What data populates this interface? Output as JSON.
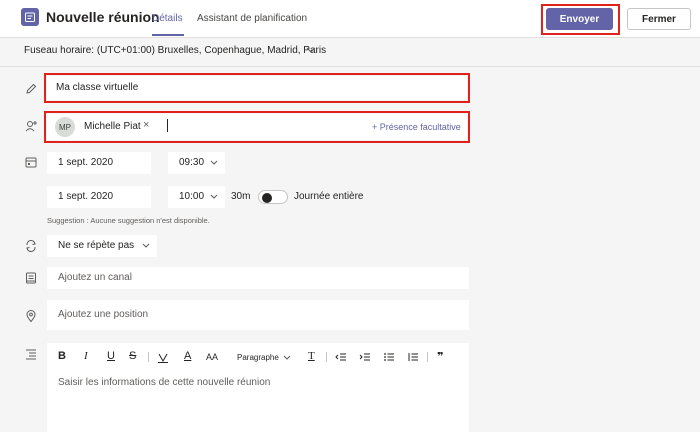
{
  "header": {
    "title": "Nouvelle réunion",
    "tabs": [
      {
        "label": "Détails",
        "active": true
      },
      {
        "label": "Assistant de planification",
        "active": false
      }
    ],
    "send_label": "Envoyer",
    "close_label": "Fermer"
  },
  "timezone": {
    "label": "Fuseau horaire: (UTC+01:00) Bruxelles, Copenhague, Madrid, Paris"
  },
  "subject": {
    "value": "Ma classe virtuelle"
  },
  "attendees": {
    "chips": [
      {
        "initials": "MP",
        "name": "Michelle Piat"
      }
    ],
    "optional_label": "+ Présence facultative"
  },
  "start": {
    "date": "1 sept. 2020",
    "time": "09:30"
  },
  "end": {
    "date": "1 sept. 2020",
    "time": "10:00",
    "duration": "30m",
    "all_day_label": "Journée entière",
    "all_day_on": false
  },
  "suggestion": "Suggestion : Aucune suggestion n'est disponible.",
  "recurrence": {
    "value": "Ne se répète pas"
  },
  "channel": {
    "placeholder": "Ajoutez un canal"
  },
  "location": {
    "placeholder": "Ajoutez une position"
  },
  "editor": {
    "toolbar": {
      "bold": "B",
      "italic": "I",
      "underline": "U",
      "strike": "S",
      "font_size": "A",
      "font_size_small": "AA",
      "paragraph": "Paragraphe",
      "clear_format": "T",
      "quote": "❞"
    },
    "placeholder": "Saisir les informations de cette nouvelle réunion"
  },
  "colors": {
    "accent": "#6264a7",
    "highlight_border": "#e0221c",
    "background": "#f5f5f5"
  }
}
